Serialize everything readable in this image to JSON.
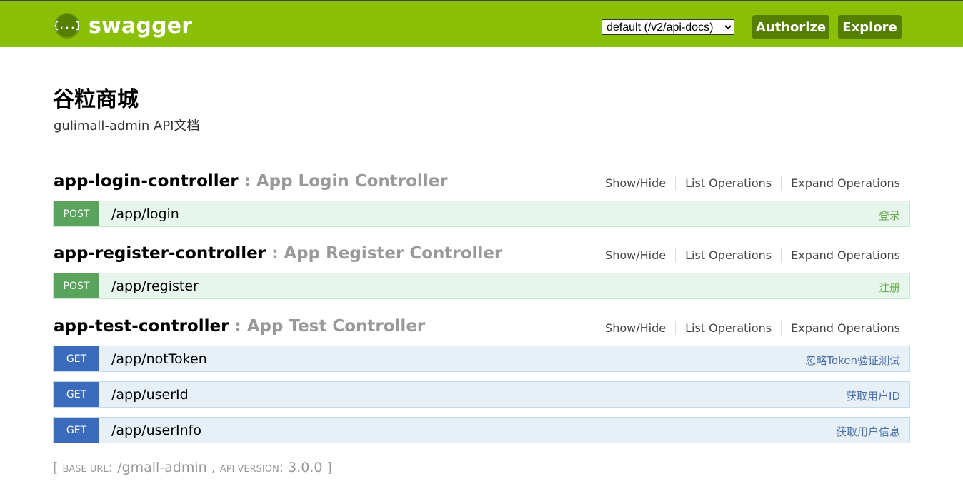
{
  "header": {
    "logo_glyph": "{...}",
    "brand": "swagger",
    "spec_selected": "default (/v2/api-docs)",
    "authorize_label": "Authorize",
    "explore_label": "Explore",
    "color_bar": "#89bf04",
    "color_button": "#547f00"
  },
  "info": {
    "title": "谷粒商城",
    "description": "gulimall-admin API文档"
  },
  "options": {
    "show_hide": "Show/Hide",
    "list_operations": "List Operations",
    "expand_operations": "Expand Operations"
  },
  "resources": [
    {
      "name": "app-login-controller",
      "description": " : App Login Controller",
      "operations": [
        {
          "method": "POST",
          "path": "/app/login",
          "summary": "登录"
        }
      ]
    },
    {
      "name": "app-register-controller",
      "description": " : App Register Controller",
      "operations": [
        {
          "method": "POST",
          "path": "/app/register",
          "summary": "注册"
        }
      ]
    },
    {
      "name": "app-test-controller",
      "description": " : App Test Controller",
      "operations": [
        {
          "method": "GET",
          "path": "/app/notToken",
          "summary": "忽略Token验证测试"
        },
        {
          "method": "GET",
          "path": "/app/userId",
          "summary": "获取用户ID"
        },
        {
          "method": "GET",
          "path": "/app/userInfo",
          "summary": "获取用户信息"
        }
      ]
    }
  ],
  "footer": {
    "open": "[ ",
    "base_url_label": "Base URL",
    "sep1": ": ",
    "base_url": "/gmall-admin",
    "comma": " , ",
    "api_version_label": "Api Version",
    "sep2": ": ",
    "api_version": "3.0.0",
    "close": " ]"
  }
}
